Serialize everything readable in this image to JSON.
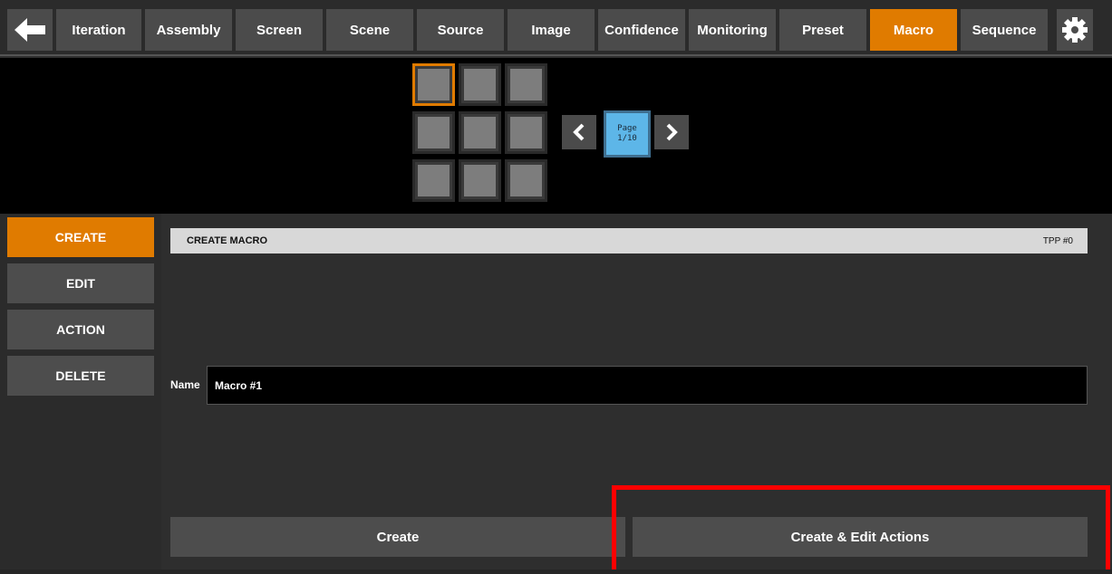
{
  "topnav": {
    "back_icon": "arrow-left-icon",
    "tabs": [
      {
        "label": "Iteration"
      },
      {
        "label": "Assembly"
      },
      {
        "label": "Screen"
      },
      {
        "label": "Scene"
      },
      {
        "label": "Source"
      },
      {
        "label": "Image"
      },
      {
        "label": "Confidence"
      },
      {
        "label": "Monitoring"
      },
      {
        "label": "Preset"
      },
      {
        "label": "Macro"
      },
      {
        "label": "Sequence"
      }
    ],
    "active_tab": "Macro",
    "settings_icon": "gear-icon"
  },
  "preview": {
    "grid_rows": 3,
    "grid_cols": 3,
    "selected_cell": 0,
    "prev_icon": "chevron-left-icon",
    "next_icon": "chevron-right-icon",
    "page_label": "Page",
    "page_value": "1/10"
  },
  "sidebar": {
    "items": [
      {
        "label": "CREATE"
      },
      {
        "label": "EDIT"
      },
      {
        "label": "ACTION"
      },
      {
        "label": "DELETE"
      }
    ],
    "active": "CREATE"
  },
  "panel": {
    "title": "CREATE MACRO",
    "tpp": "TPP #0",
    "name_label": "Name",
    "name_value": "Macro #1",
    "create_label": "Create",
    "create_edit_label": "Create & Edit Actions"
  },
  "colors": {
    "accent": "#e07b00",
    "page_indicator": "#5db6e8",
    "highlight": "#ff0000"
  }
}
